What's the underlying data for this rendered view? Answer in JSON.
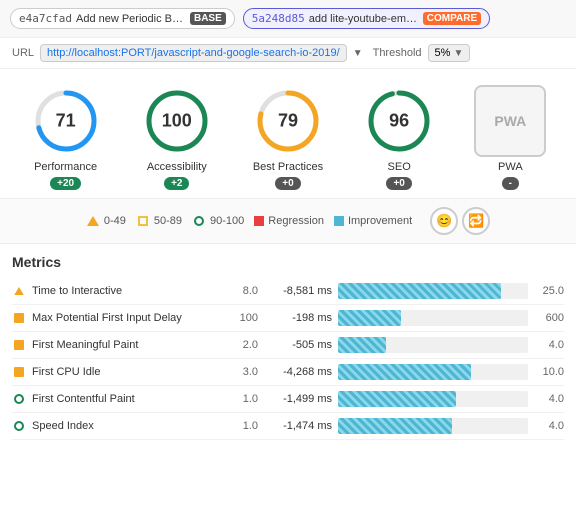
{
  "topbar": {
    "base": {
      "hash": "e4a7cfad",
      "label": "Add new Periodic Bac...",
      "badge": "BASE"
    },
    "compare": {
      "hash": "5a248d85",
      "label": "add lite-youtube-embed",
      "badge": "COMPARE"
    }
  },
  "urlbar": {
    "url_label": "URL",
    "url": "http://localhost:PORT/javascript-and-google-search-io-2019/",
    "threshold_label": "Threshold",
    "threshold": "5%"
  },
  "scores": [
    {
      "id": "performance",
      "name": "Performance",
      "value": 71,
      "delta": "+20",
      "delta_type": "green",
      "color": "#2196f3",
      "ring_pct": 0.71
    },
    {
      "id": "accessibility",
      "name": "Accessibility",
      "value": 100,
      "delta": "+2",
      "delta_type": "green",
      "color": "#1a8754",
      "ring_pct": 1.0
    },
    {
      "id": "best-practices",
      "name": "Best Practices",
      "value": 79,
      "delta": "+0",
      "delta_type": "dark",
      "color": "#f4a623",
      "ring_pct": 0.79
    },
    {
      "id": "seo",
      "name": "SEO",
      "value": 96,
      "delta": "+0",
      "delta_type": "dark",
      "color": "#1a8754",
      "ring_pct": 0.96
    },
    {
      "id": "pwa",
      "name": "PWA",
      "delta": "-",
      "delta_type": "dark"
    }
  ],
  "legend": {
    "items": [
      {
        "id": "0-49",
        "label": "0-49",
        "icon_type": "triangle"
      },
      {
        "id": "50-89",
        "label": "50-89",
        "icon_type": "square-yellow"
      },
      {
        "id": "90-100",
        "label": "90-100",
        "icon_type": "circle-green"
      },
      {
        "id": "regression",
        "label": "Regression",
        "icon_type": "sq-red"
      },
      {
        "id": "improvement",
        "label": "Improvement",
        "icon_type": "sq-blue"
      }
    ],
    "btn1": "😊",
    "btn2": "🔁"
  },
  "metrics": {
    "title": "Metrics",
    "rows": [
      {
        "id": "time-to-interactive",
        "name": "Time to Interactive",
        "icon": "triangle",
        "base": "8.0",
        "delta": "-8,581 ms",
        "bar_pct": 86,
        "max": "25.0"
      },
      {
        "id": "max-potential-fid",
        "name": "Max Potential First Input Delay",
        "icon": "square-orange",
        "base": "100",
        "delta": "-198 ms",
        "bar_pct": 33,
        "max": "600"
      },
      {
        "id": "first-meaningful-paint",
        "name": "First Meaningful Paint",
        "icon": "square-orange",
        "base": "2.0",
        "delta": "-505 ms",
        "bar_pct": 25,
        "max": "4.0"
      },
      {
        "id": "first-cpu-idle",
        "name": "First CPU Idle",
        "icon": "square-orange",
        "base": "3.0",
        "delta": "-4,268 ms",
        "bar_pct": 70,
        "max": "10.0"
      },
      {
        "id": "first-contentful-paint",
        "name": "First Contentful Paint",
        "icon": "circle-green",
        "base": "1.0",
        "delta": "-1,499 ms",
        "bar_pct": 62,
        "max": "4.0"
      },
      {
        "id": "speed-index",
        "name": "Speed Index",
        "icon": "circle-green",
        "base": "1.0",
        "delta": "-1,474 ms",
        "bar_pct": 60,
        "max": "4.0"
      }
    ]
  }
}
